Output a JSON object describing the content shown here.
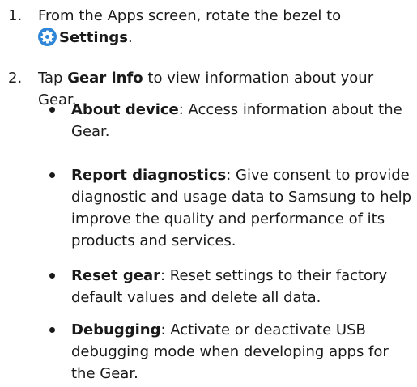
{
  "steps": [
    {
      "number": "1.",
      "line1": "From the Apps screen, rotate the bezel to",
      "icon": "settings-gear-icon",
      "bold": "Settings",
      "suffix": "."
    },
    {
      "number": "2.",
      "prefix": "Tap ",
      "bold": "Gear info",
      "suffix": " to view information about your Gear."
    }
  ],
  "bullets": [
    {
      "term": "About device",
      "desc": ": Access information about the Gear."
    },
    {
      "term": "Report diagnostics",
      "desc": ": Give consent to provide diagnostic and usage data to Samsung to help improve the quality and performance of its products and services."
    },
    {
      "term": "Reset gear",
      "desc": ": Reset settings to their factory default values and delete all data."
    },
    {
      "term": "Debugging",
      "desc": ": Activate or deactivate USB debugging mode when developing apps for the Gear."
    }
  ],
  "colors": {
    "text": "#1a1a1a",
    "icon_fill": "#2f86d6"
  }
}
